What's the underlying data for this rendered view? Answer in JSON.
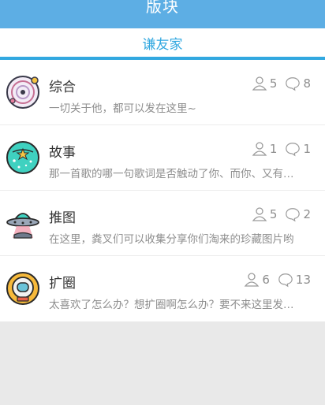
{
  "header": {
    "title": "版块"
  },
  "tabs": {
    "active_label": "谦友家"
  },
  "boards": [
    {
      "name": "综合",
      "desc": "一切关于他，都可以发在这里~",
      "members": "5",
      "comments": "8",
      "icon": "planet-icon"
    },
    {
      "name": "故事",
      "desc": "那一首歌的哪一句歌词是否触动了你、而你、又有…",
      "members": "1",
      "comments": "1",
      "icon": "star-globe-icon"
    },
    {
      "name": "推图",
      "desc": "在这里，粪叉们可以收集分享你们淘来的珍藏图片哟",
      "members": "5",
      "comments": "2",
      "icon": "ufo-icon"
    },
    {
      "name": "扩圈",
      "desc": "太喜欢了怎么办？想扩圈啊怎么办？要不来这里发…",
      "members": "6",
      "comments": "13",
      "icon": "astronaut-icon"
    }
  ],
  "colors": {
    "header_bg": "#5daee4",
    "accent": "#32a8e0",
    "text_gray": "#8e8e8e"
  }
}
